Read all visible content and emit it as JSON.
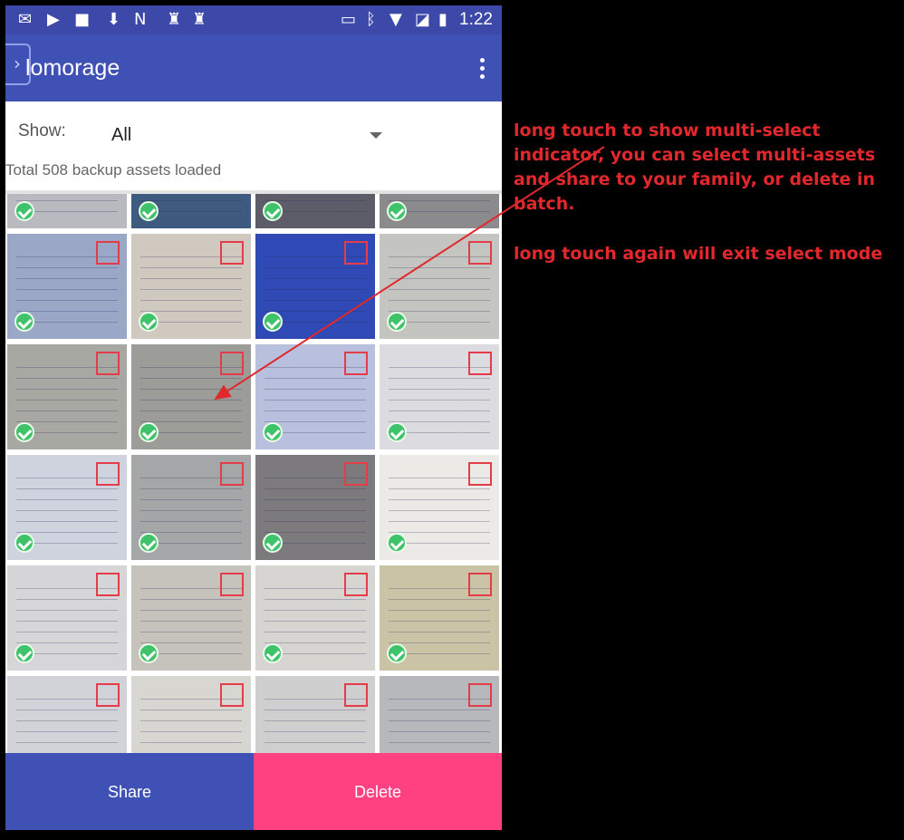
{
  "status_bar": {
    "time": "1:22",
    "icons": [
      "gmail-icon",
      "play-icon",
      "video-icon",
      "download-icon",
      "n-app-icon",
      "keyhole-icon",
      "keyhole-icon",
      "cast-icon",
      "bluetooth-icon",
      "wifi-icon",
      "no-sim-icon",
      "battery-icon"
    ]
  },
  "app_bar": {
    "title": "lomorage",
    "menu_icon": "more-vert-icon"
  },
  "filter": {
    "show_label": "Show:",
    "show_value": "All",
    "total_text": "Total 508 backup assets loaded"
  },
  "grid": {
    "rows": [
      {
        "cells": [
          {
            "thumb": "#b9b9c0",
            "checked": true
          },
          {
            "thumb": "#3e5a7e",
            "checked": true
          },
          {
            "thumb": "#5d5d6a",
            "checked": true
          },
          {
            "thumb": "#8b8b8e",
            "checked": true
          }
        ]
      },
      {
        "cells": [
          {
            "thumb": "#9aa7c7",
            "checked": true
          },
          {
            "thumb": "#cfc9c0",
            "checked": true
          },
          {
            "thumb": "#2f49b5",
            "checked": true
          },
          {
            "thumb": "#c4c4c0",
            "checked": true
          }
        ]
      },
      {
        "cells": [
          {
            "thumb": "#a8a8a2",
            "checked": true
          },
          {
            "thumb": "#9c9d98",
            "checked": true
          },
          {
            "thumb": "#b8c0dd",
            "checked": true
          },
          {
            "thumb": "#dcdce0",
            "checked": true
          }
        ]
      },
      {
        "cells": [
          {
            "thumb": "#cfd3de",
            "checked": true
          },
          {
            "thumb": "#a4a6a8",
            "checked": true
          },
          {
            "thumb": "#7c7a7c",
            "checked": true
          },
          {
            "thumb": "#eceae6",
            "checked": true
          }
        ]
      },
      {
        "cells": [
          {
            "thumb": "#d6d6d8",
            "checked": true
          },
          {
            "thumb": "#c6c2bc",
            "checked": true
          },
          {
            "thumb": "#d7d5d2",
            "checked": true
          },
          {
            "thumb": "#cac3a5",
            "checked": true
          }
        ]
      },
      {
        "cells": [
          {
            "thumb": "#d2d3d8",
            "checked": false
          },
          {
            "thumb": "#d8d6d0",
            "checked": false
          },
          {
            "thumb": "#cfcfd0",
            "checked": false
          },
          {
            "thumb": "#b7b8bc",
            "checked": false
          }
        ]
      }
    ]
  },
  "actions": {
    "share_label": "Share",
    "delete_label": "Delete"
  },
  "annotations": {
    "note1": "long touch to show multi-select indicator, you can select multi-assets and share to your family, or delete in batch.",
    "note2": "long touch again will exit select mode"
  },
  "colors": {
    "primary": "#3f51b5",
    "status_bar": "#3c49a8",
    "accent": "#ff4081",
    "check": "#3ec26a",
    "select_box": "#e53c4a",
    "annotation": "#e0282d"
  }
}
